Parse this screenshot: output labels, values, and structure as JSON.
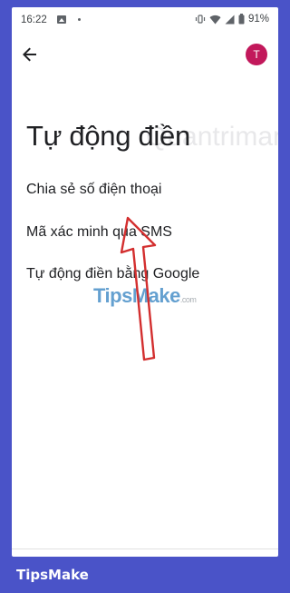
{
  "status_bar": {
    "time": "16:22",
    "battery": "91%"
  },
  "app_bar": {
    "avatar_letter": "T"
  },
  "page": {
    "title": "Tự động điền",
    "title_watermark": "Quantrimang"
  },
  "menu": {
    "items": [
      {
        "label": "Chia sẻ số điện thoại"
      },
      {
        "label": "Mã xác minh qua SMS"
      },
      {
        "label": "Tự động điền bằng Google"
      }
    ]
  },
  "watermark": {
    "brand": "TipsMake",
    "suffix": ".com"
  },
  "footer": {
    "brand": "TipsMake"
  },
  "colors": {
    "frame": "#4a53c8",
    "avatar": "#c2185b",
    "arrow": "#d32f2f"
  }
}
